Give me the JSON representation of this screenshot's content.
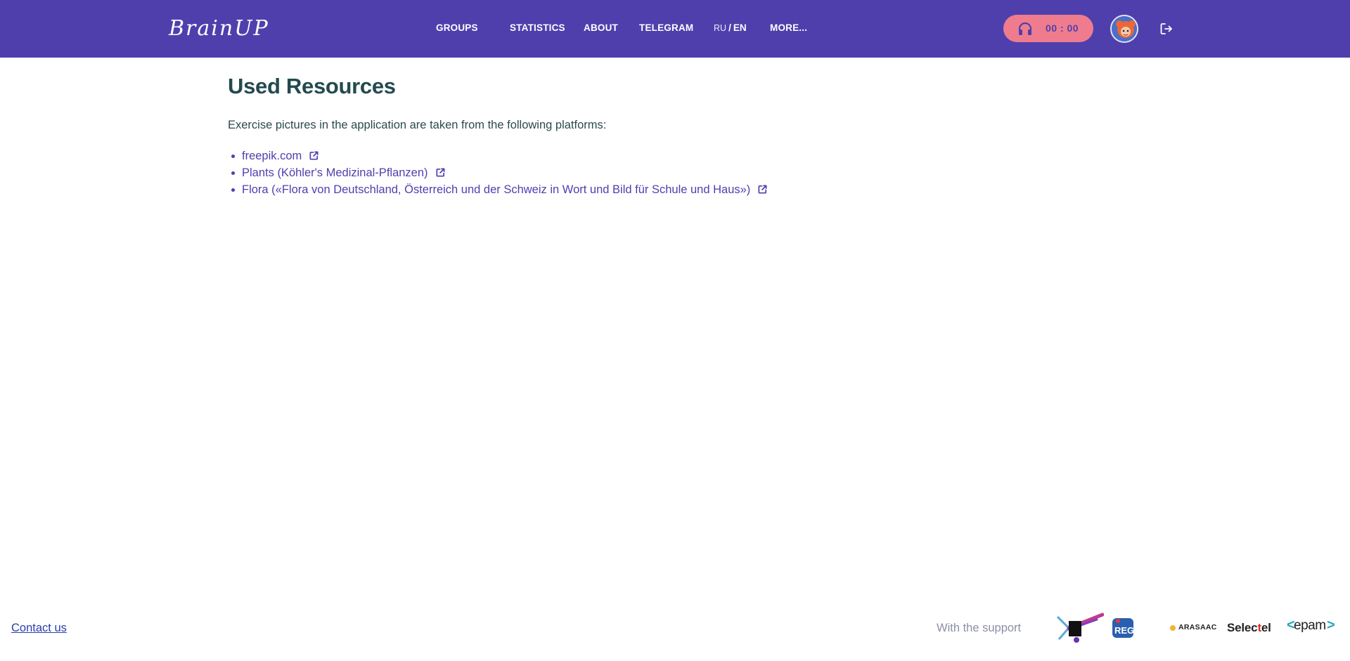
{
  "header": {
    "logo": "BrainUP",
    "nav": [
      {
        "label": "GROUPS"
      },
      {
        "label": "STATISTICS"
      },
      {
        "label": "ABOUT"
      },
      {
        "label": "TELEGRAM"
      }
    ],
    "lang": {
      "ru": "RU",
      "sep": "/",
      "en": "EN"
    },
    "more_label": "MORE...",
    "timer": "00 : 00",
    "colors": {
      "background": "#4f3fad",
      "timer": "#ef7c8e"
    }
  },
  "main": {
    "title": "Used Resources",
    "intro": "Exercise pictures in the application are taken from the following platforms:",
    "resources": [
      {
        "label": "freepik.com"
      },
      {
        "label": "Plants (Köhler's Medizinal-Pflanzen)"
      },
      {
        "label": "Flora («Flora von Deutschland, Österreich und der Schweiz in Wort und Bild für Schule und Haus»)"
      }
    ]
  },
  "footer": {
    "contact": "Contact us",
    "support_label": "With the support",
    "sponsors": {
      "regru": "REG.RU",
      "arasaac": "ARASAAC",
      "selectel_pre": "Selec",
      "selectel_t": "t",
      "selectel_post": "el",
      "epam": "epam"
    }
  }
}
